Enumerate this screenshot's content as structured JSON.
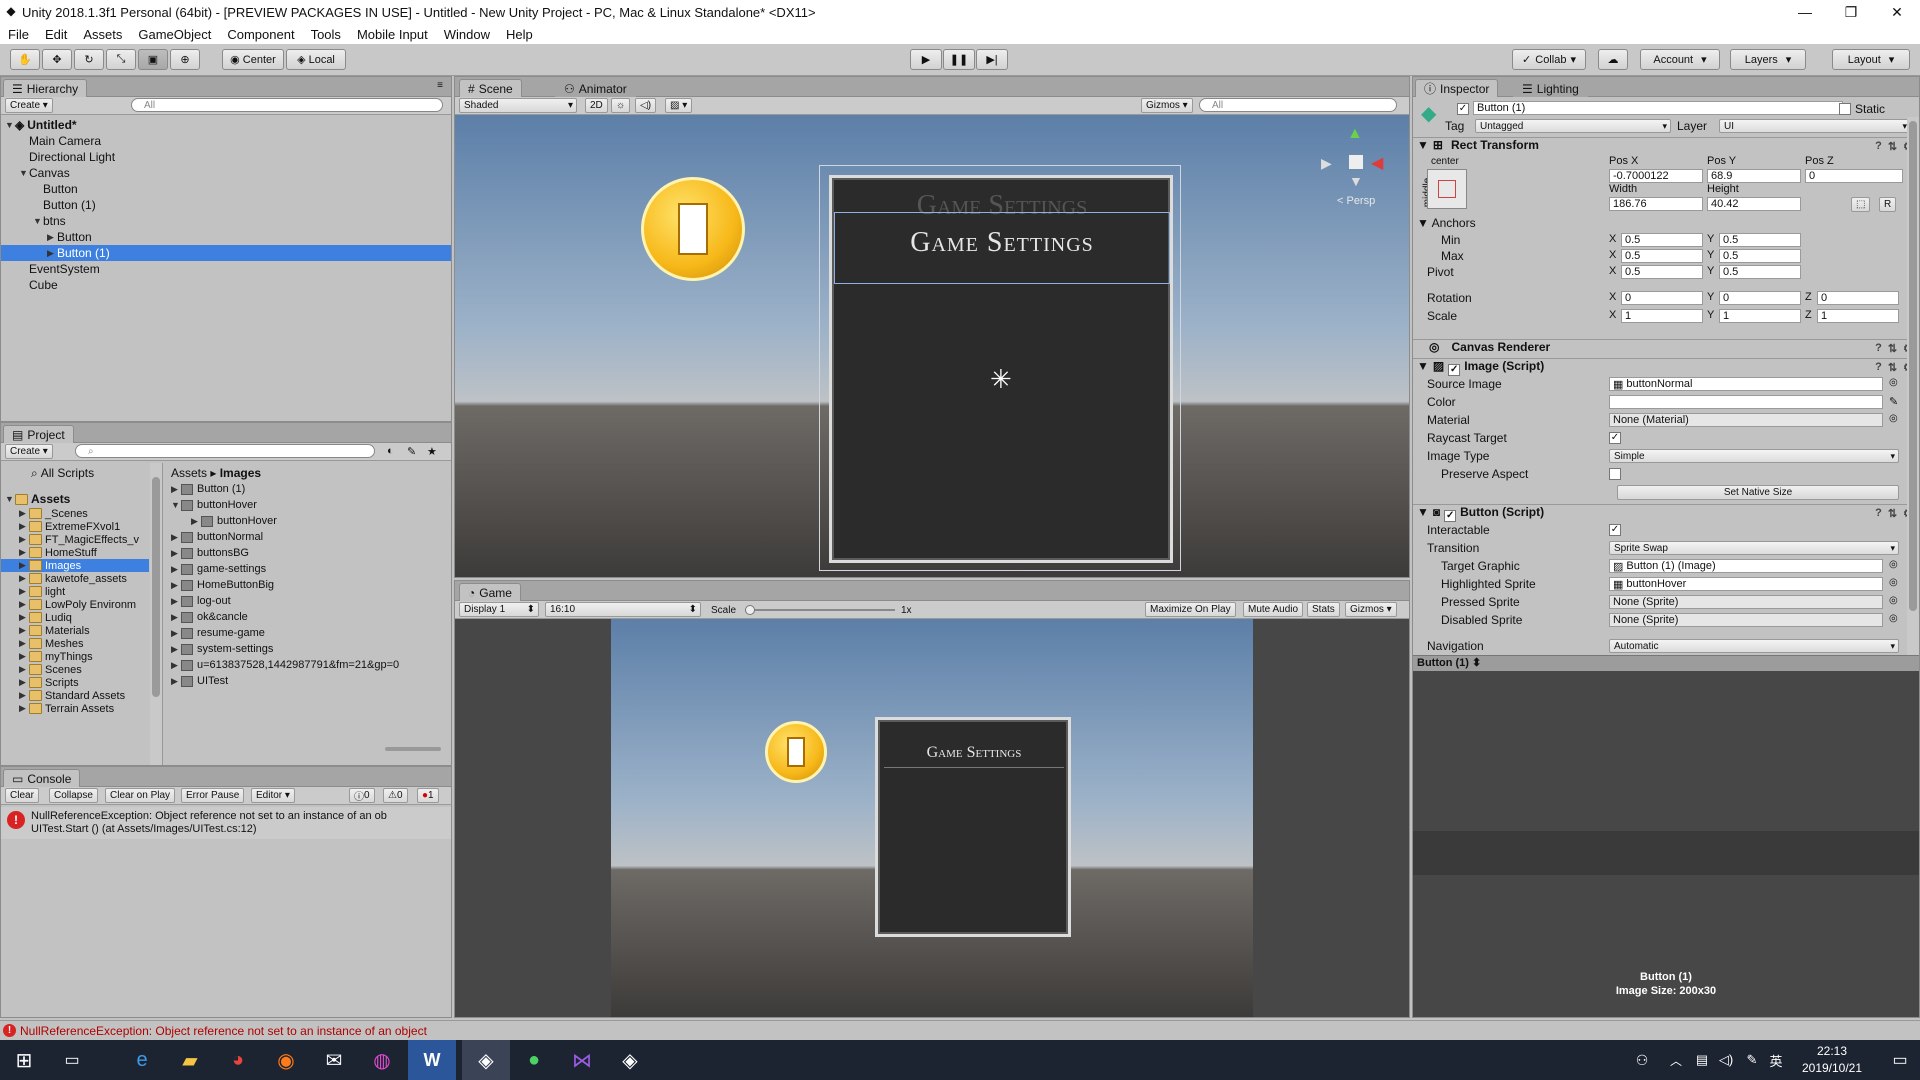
{
  "window": {
    "title": "Unity 2018.1.3f1 Personal (64bit) - [PREVIEW PACKAGES IN USE] - Untitled - New Unity Project - PC, Mac & Linux Standalone* <DX11>",
    "controls": [
      "—",
      "❐",
      "✕"
    ]
  },
  "menu": [
    "File",
    "Edit",
    "Assets",
    "GameObject",
    "Component",
    "Tools",
    "Mobile Input",
    "Window",
    "Help"
  ],
  "toolbar": {
    "pivot_mode": "Center",
    "pivot_rotation": "Local",
    "collab": "Collab",
    "account": "Account",
    "layers": "Layers",
    "layout": "Layout"
  },
  "hierarchy": {
    "tab": "Hierarchy",
    "create": "Create",
    "search_placeholder": "All",
    "scene": "Untitled*",
    "items": [
      {
        "label": "Main Camera",
        "indent": 1
      },
      {
        "label": "Directional Light",
        "indent": 1
      },
      {
        "label": "Canvas",
        "indent": 1,
        "fold": "▼"
      },
      {
        "label": "Button",
        "indent": 2
      },
      {
        "label": "Button (1)",
        "indent": 2
      },
      {
        "label": "btns",
        "indent": 2,
        "fold": "▼"
      },
      {
        "label": "Button",
        "indent": 3,
        "fold": "▶"
      },
      {
        "label": "Button (1)",
        "indent": 3,
        "fold": "▶",
        "selected": true
      },
      {
        "label": "EventSystem",
        "indent": 1
      },
      {
        "label": "Cube",
        "indent": 1
      }
    ]
  },
  "project": {
    "tab": "Project",
    "create": "Create",
    "favorites": "All Scripts",
    "root": "Assets",
    "folders": [
      "_Scenes",
      "ExtremeFXvol1",
      "FT_MagicEffects_v",
      "HomeStuff",
      "Images",
      "kawetofe_assets",
      "light",
      "LowPoly Environm",
      "Ludiq",
      "Materials",
      "Meshes",
      "myThings",
      "Scenes",
      "Scripts",
      "Standard Assets",
      "Terrain Assets"
    ],
    "selected_folder": "Images",
    "breadcrumb": [
      "Assets",
      "Images"
    ],
    "files": [
      "Button (1)",
      "buttonHover",
      "buttonHover",
      "buttonNormal",
      "buttonsBG",
      "game-settings",
      "HomeButtonBig",
      "log-out",
      "ok&cancle",
      "resume-game",
      "system-settings",
      "u=613837528,1442987791&fm=21&gp=0",
      "UITest"
    ]
  },
  "console": {
    "tab": "Console",
    "buttons": [
      "Clear",
      "Collapse",
      "Clear on Play",
      "Error Pause",
      "Editor"
    ],
    "counts": {
      "info": "0",
      "warn": "0",
      "error": "1"
    },
    "message_line1": "NullReferenceException: Object reference not set to an instance of an ob",
    "message_line2": "UITest.Start () (at Assets/Images/UITest.cs:12)"
  },
  "scene_view": {
    "tabs": [
      "Scene",
      "Animator"
    ],
    "shading": "Shaded",
    "mode_2d": "2D",
    "gizmos": "Gizmos",
    "search_placeholder": "All",
    "persp": "< Persp",
    "card_title": "Game Settings",
    "card_title_ghost": "Game Settings"
  },
  "game_view": {
    "tab": "Game",
    "display": "Display 1",
    "aspect": "16:10",
    "scale_label": "Scale",
    "scale_value": "1x",
    "toggles": [
      "Maximize On Play",
      "Mute Audio",
      "Stats",
      "Gizmos"
    ],
    "card_title": "Game Settings"
  },
  "inspector": {
    "tabs": [
      "Inspector",
      "Lighting"
    ],
    "object_name": "Button (1)",
    "static": "Static",
    "tag_label": "Tag",
    "tag": "Untagged",
    "layer_label": "Layer",
    "layer": "UI",
    "rect_transform": {
      "header": "Rect Transform",
      "anchor_h": "center",
      "anchor_v": "middle",
      "pos_labels": [
        "Pos X",
        "Pos Y",
        "Pos Z"
      ],
      "pos": [
        "-0.7000122",
        "68.9",
        "0"
      ],
      "size_labels": [
        "Width",
        "Height"
      ],
      "size": [
        "186.76",
        "40.42"
      ],
      "raw_btn": "R",
      "anchors": "Anchors",
      "min_label": "Min",
      "min": [
        "0.5",
        "0.5"
      ],
      "max_label": "Max",
      "max": [
        "0.5",
        "0.5"
      ],
      "pivot_label": "Pivot",
      "pivot": [
        "0.5",
        "0.5"
      ],
      "rotation_label": "Rotation",
      "rotation": [
        "0",
        "0",
        "0"
      ],
      "scale_label": "Scale",
      "scale": [
        "1",
        "1",
        "1"
      ]
    },
    "canvas_renderer": "Canvas Renderer",
    "image_script": {
      "header": "Image (Script)",
      "source_image_label": "Source Image",
      "source_image": "buttonNormal",
      "color_label": "Color",
      "material_label": "Material",
      "material": "None (Material)",
      "raycast_label": "Raycast Target",
      "image_type_label": "Image Type",
      "image_type": "Simple",
      "preserve_label": "Preserve Aspect",
      "native_size": "Set Native Size"
    },
    "button_script": {
      "header": "Button (Script)",
      "interactable_label": "Interactable",
      "transition_label": "Transition",
      "transition": "Sprite Swap",
      "target_graphic_label": "Target Graphic",
      "target_graphic": "Button (1) (Image)",
      "highlighted_label": "Highlighted Sprite",
      "highlighted": "buttonHover",
      "pressed_label": "Pressed Sprite",
      "pressed": "None (Sprite)",
      "disabled_label": "Disabled Sprite",
      "disabled": "None (Sprite)",
      "navigation_label": "Navigation",
      "navigation": "Automatic"
    },
    "preview_title": "Button (1)",
    "preview_name": "Button (1)",
    "preview_size": "Image Size: 200x30"
  },
  "status_bar": "NullReferenceException: Object reference not set to an instance of an object",
  "taskbar": {
    "time": "22:13",
    "date": "2019/10/21",
    "ime": "英",
    "icons": [
      "windows-start-icon",
      "task-view-icon",
      "edge-icon",
      "file-explorer-icon",
      "chrome-icon",
      "firefox-icon",
      "mail-icon",
      "colorful-app-icon",
      "word-icon",
      "unity-icon",
      "wechat-icon",
      "visual-studio-icon",
      "unity-hub-icon"
    ]
  }
}
